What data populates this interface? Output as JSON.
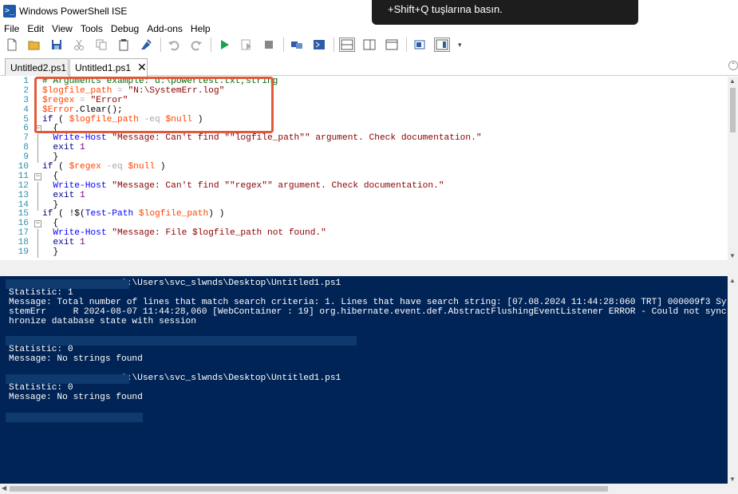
{
  "window": {
    "title": "Windows PowerShell ISE"
  },
  "toast": {
    "text": "+Shift+Q tuşlarına basın."
  },
  "menu": [
    "File",
    "Edit",
    "View",
    "Tools",
    "Debug",
    "Add-ons",
    "Help"
  ],
  "toolbar": {
    "icons": [
      "new-file-icon",
      "open-file-icon",
      "save-icon",
      "cut-icon",
      "copy-icon",
      "paste-icon",
      "clear-console-icon",
      "undo-icon",
      "redo-icon",
      "run-script-icon",
      "run-selection-icon",
      "stop-icon",
      "remote-powershell-icon",
      "powershell-console-icon",
      "show-script-pane-top-icon",
      "show-script-pane-right-icon",
      "show-script-pane-maximized-icon",
      "show-command-window-icon",
      "show-command-addon-icon"
    ]
  },
  "tabs": [
    {
      "label": "Untitled2.ps1",
      "active": false
    },
    {
      "label": "Untitled1.ps1",
      "active": true,
      "close": "✕"
    }
  ],
  "editor": {
    "lines": [
      {
        "num": "1",
        "fold": "",
        "segments": [
          [
            "c-comment",
            "# Arguments example: d:\\powertest.txt,string"
          ]
        ]
      },
      {
        "num": "2",
        "fold": "",
        "segments": [
          [
            "c-var",
            "$logfile_path"
          ],
          [
            "c-op",
            " = "
          ],
          [
            "c-str",
            "\"N:\\SystemErr.log\""
          ]
        ]
      },
      {
        "num": "3",
        "fold": "",
        "segments": [
          [
            "c-var",
            "$regex"
          ],
          [
            "c-op",
            " = "
          ],
          [
            "c-str",
            "\"Error\""
          ]
        ]
      },
      {
        "num": "4",
        "fold": "",
        "segments": [
          [
            "c-var",
            "$Error"
          ],
          [
            "c-plain",
            ".Clear();"
          ]
        ]
      },
      {
        "num": "5",
        "fold": "",
        "segments": [
          [
            "c-kw",
            "if"
          ],
          [
            "c-plain",
            " ( "
          ],
          [
            "c-var",
            "$logfile_path"
          ],
          [
            "c-op",
            " -eq "
          ],
          [
            "c-var",
            "$null"
          ],
          [
            "c-plain",
            " )"
          ]
        ]
      },
      {
        "num": "6",
        "fold": "minus",
        "segments": [
          [
            "c-plain",
            "  {"
          ]
        ]
      },
      {
        "num": "7",
        "fold": "line",
        "segments": [
          [
            "c-cmd",
            "  Write-Host"
          ],
          [
            "c-str",
            " \"Message: Can't find \"\"logfile_path\"\" argument. Check documentation.\""
          ]
        ]
      },
      {
        "num": "8",
        "fold": "line",
        "segments": [
          [
            "c-kw",
            "  exit"
          ],
          [
            "c-num",
            " 1"
          ]
        ]
      },
      {
        "num": "9",
        "fold": "line",
        "segments": [
          [
            "c-plain",
            "  }"
          ]
        ]
      },
      {
        "num": "10",
        "fold": "",
        "segments": [
          [
            "c-kw",
            "if"
          ],
          [
            "c-plain",
            " ( "
          ],
          [
            "c-var",
            "$regex"
          ],
          [
            "c-op",
            " -eq "
          ],
          [
            "c-var",
            "$null"
          ],
          [
            "c-plain",
            " )"
          ]
        ]
      },
      {
        "num": "11",
        "fold": "minus",
        "segments": [
          [
            "c-plain",
            "  {"
          ]
        ]
      },
      {
        "num": "12",
        "fold": "line",
        "segments": [
          [
            "c-cmd",
            "  Write-Host"
          ],
          [
            "c-str",
            " \"Message: Can't find \"\"regex\"\" argument. Check documentation.\""
          ]
        ]
      },
      {
        "num": "13",
        "fold": "line",
        "segments": [
          [
            "c-kw",
            "  exit"
          ],
          [
            "c-num",
            " 1"
          ]
        ]
      },
      {
        "num": "14",
        "fold": "line",
        "segments": [
          [
            "c-plain",
            "  }"
          ]
        ]
      },
      {
        "num": "15",
        "fold": "",
        "segments": [
          [
            "c-kw",
            "if"
          ],
          [
            "c-plain",
            " ( !$("
          ],
          [
            "c-cmd",
            "Test-Path"
          ],
          [
            "c-plain",
            " "
          ],
          [
            "c-var",
            "$logfile_path"
          ],
          [
            "c-plain",
            ") )"
          ]
        ]
      },
      {
        "num": "16",
        "fold": "minus",
        "segments": [
          [
            "c-plain",
            "  {"
          ]
        ]
      },
      {
        "num": "17",
        "fold": "line",
        "segments": [
          [
            "c-cmd",
            "  Write-Host"
          ],
          [
            "c-str",
            " \"Message: File $logfile_path not found.\""
          ]
        ]
      },
      {
        "num": "18",
        "fold": "line",
        "segments": [
          [
            "c-kw",
            "  exit"
          ],
          [
            "c-num",
            " 1"
          ]
        ]
      },
      {
        "num": "19",
        "fold": "line",
        "segments": [
          [
            "c-plain",
            "  }"
          ]
        ]
      }
    ]
  },
  "console": {
    "lines": [
      {
        "text": "                     C:\\Users\\svc_slwnds\\Desktop\\Untitled1.ps1",
        "redact": 155
      },
      {
        "text": "Statistic: 1"
      },
      {
        "text": "Message: Total number of lines that match search criteria: 1. Lines that have search string: [07.08.2024 11:44:28:060 TRT] 000009f3 Sy"
      },
      {
        "text": "stemErr     R 2024-08-07 11:44:28,060 [WebContainer : 19] org.hibernate.event.def.AbstractFlushingEventListener ERROR - Could not sync"
      },
      {
        "text": "hronize database state with session"
      },
      {
        "text": "",
        "gap": true
      },
      {
        "text": "",
        "redact": 440
      },
      {
        "text": "Statistic: 0"
      },
      {
        "text": "Message: No strings found"
      },
      {
        "text": "",
        "gap": true
      },
      {
        "text": "                     C:\\Users\\svc_slwnds\\Desktop\\Untitled1.ps1",
        "redact": 155
      },
      {
        "text": "Statistic: 0"
      },
      {
        "text": "Message: No strings found"
      },
      {
        "text": "",
        "gap": true
      },
      {
        "text": "",
        "redact": 172
      }
    ]
  },
  "colors": {
    "console_bg": "#012456",
    "highlight": "#e05a3a",
    "comment": "#006400",
    "variable": "#ff4500",
    "string": "#8b0000",
    "keyword": "#00008b",
    "cmdlet": "#0000ff"
  }
}
